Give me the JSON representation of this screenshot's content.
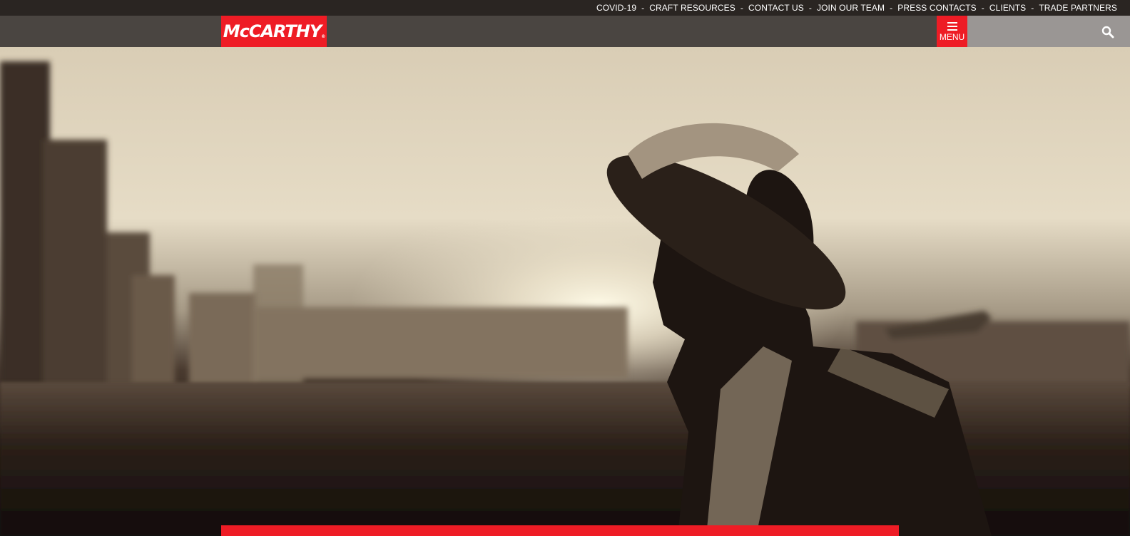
{
  "top_nav": {
    "links": [
      "COVID-19",
      "CRAFT RESOURCES",
      "CONTACT US",
      "JOIN OUR TEAM",
      "PRESS CONTACTS",
      "CLIENTS",
      "TRADE PARTNERS"
    ],
    "separator": "-"
  },
  "header": {
    "logo_text": "McCARTHY",
    "logo_registered": "®",
    "menu_label": "MENU",
    "menu_icon": "hamburger-icon",
    "search_icon": "search-icon"
  },
  "colors": {
    "brand_red": "#ee1c25",
    "top_bar": "#2a2522",
    "nav_bar": "#4a4541",
    "search_bg": "#9a9694"
  },
  "hero": {
    "image_subject": "construction-worker-silhouette-sepia"
  }
}
